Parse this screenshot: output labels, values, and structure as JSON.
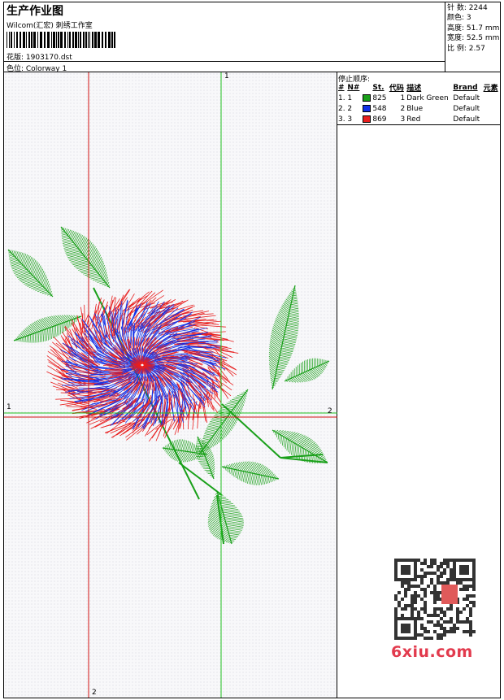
{
  "header": {
    "title": "生产作业图",
    "subtitle": "Wilcom(汇宏) 刺绣工作室",
    "design_label": "花版: 1903170.dst",
    "colorway_label": "色位: Colorway 1"
  },
  "stats": [
    {
      "label": "针 数:",
      "value": "2244"
    },
    {
      "label": "颜色:",
      "value": "3"
    },
    {
      "label": "高度:",
      "value": "51.7 mm"
    },
    {
      "label": "宽度:",
      "value": "52.5 mm"
    },
    {
      "label": "比 例:",
      "value": "2.57"
    }
  ],
  "stop_sequence": {
    "title": "停止顺序:",
    "columns": [
      "#",
      "N#",
      "St.",
      "代码",
      "描述",
      "Brand",
      "元素"
    ],
    "rows": [
      {
        "index": "1.",
        "n": "1",
        "color": "#1aa01a",
        "stitches": "825",
        "code": "1",
        "desc": "Dark Green",
        "brand": "Default",
        "element": ""
      },
      {
        "index": "2.",
        "n": "2",
        "color": "#1230e8",
        "stitches": "548",
        "code": "2",
        "desc": "Blue",
        "brand": "Default",
        "element": ""
      },
      {
        "index": "3.",
        "n": "3",
        "color": "#e81e1e",
        "stitches": "869",
        "code": "3",
        "desc": "Red",
        "brand": "Default",
        "element": ""
      }
    ]
  },
  "axes": {
    "top_label": "1",
    "left_label": "1",
    "right_label": "2",
    "bottom_label": "2"
  },
  "watermark": {
    "text": "6xiu.com"
  },
  "colors": {
    "red_axis": "#d01010",
    "green_axis": "#20c020"
  }
}
